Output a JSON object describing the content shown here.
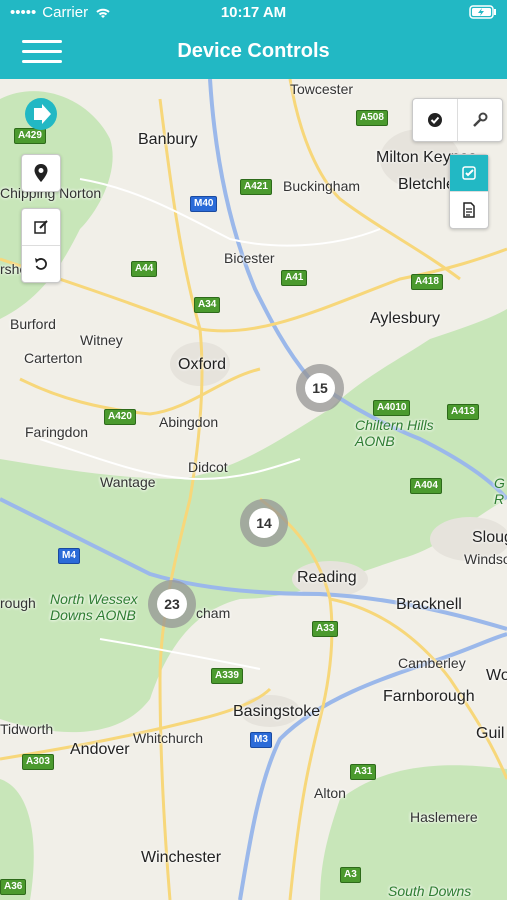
{
  "status_bar": {
    "carrier": "Carrier",
    "time": "10:17 AM"
  },
  "header": {
    "title": "Device Controls"
  },
  "map": {
    "places": [
      "Towcester",
      "Banbury",
      "Milton Keynes",
      "Buckingham",
      "Bletchley",
      "Bicester",
      "Aylesbury",
      "Burford",
      "Witney",
      "Carterton",
      "Oxford",
      "Abingdon",
      "Faringdon",
      "Didcot",
      "Wantage",
      "Reading",
      "Bracknell",
      "Slough",
      "Windsor",
      "Basingstoke",
      "Andover",
      "Whitchurch",
      "Winchester",
      "Alton",
      "Farnborough",
      "Camberley",
      "Haslemere",
      "Tidworth",
      "rough",
      "cham",
      "Guil",
      "Wo",
      "Chiltern Hills AONB",
      "North Wessex Downs AONB",
      "South Downs",
      "Chipping Norton",
      "rshe-W",
      "G R"
    ],
    "roads": [
      "A429",
      "A508",
      "A421",
      "M40",
      "A44",
      "A34",
      "A41",
      "A418",
      "A420",
      "A4010",
      "A413",
      "A404",
      "M4",
      "A33",
      "A339",
      "M3",
      "A303",
      "A31",
      "A3",
      "A36"
    ],
    "clusters": [
      "15",
      "14",
      "23"
    ]
  }
}
